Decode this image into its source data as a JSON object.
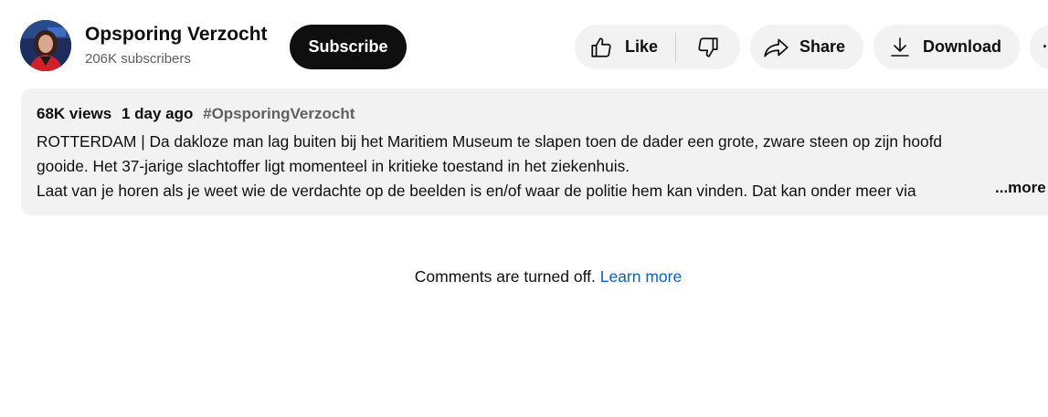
{
  "channel": {
    "name": "Opsporing Verzocht",
    "subscribers": "206K subscribers",
    "subscribe_label": "Subscribe"
  },
  "actions": {
    "like_label": "Like",
    "share_label": "Share",
    "download_label": "Download",
    "more_label": "···"
  },
  "description": {
    "views": "68K views",
    "date": "1 day ago",
    "hashtag": "#OpsporingVerzocht",
    "line1": "ROTTERDAM | Da dakloze man lag buiten bij het Maritiem Museum te slapen toen de dader een grote, zware steen op zijn hoofd",
    "line2": "gooide. Het 37-jarige slachtoffer ligt momenteel in kritieke toestand in het ziekenhuis.",
    "line3": "Laat van je horen als je weet wie de verdachte op de beelden is en/of waar de politie hem kan vinden. Dat kan onder meer via",
    "more_label": "...more"
  },
  "comments": {
    "status_text": "Comments are turned off.",
    "learn_more": "Learn more"
  },
  "colors": {
    "pill_bg": "#f2f2f2",
    "subscribe_bg": "#0f0f0f",
    "link_blue": "#065fd4",
    "secondary_text": "#606060"
  }
}
